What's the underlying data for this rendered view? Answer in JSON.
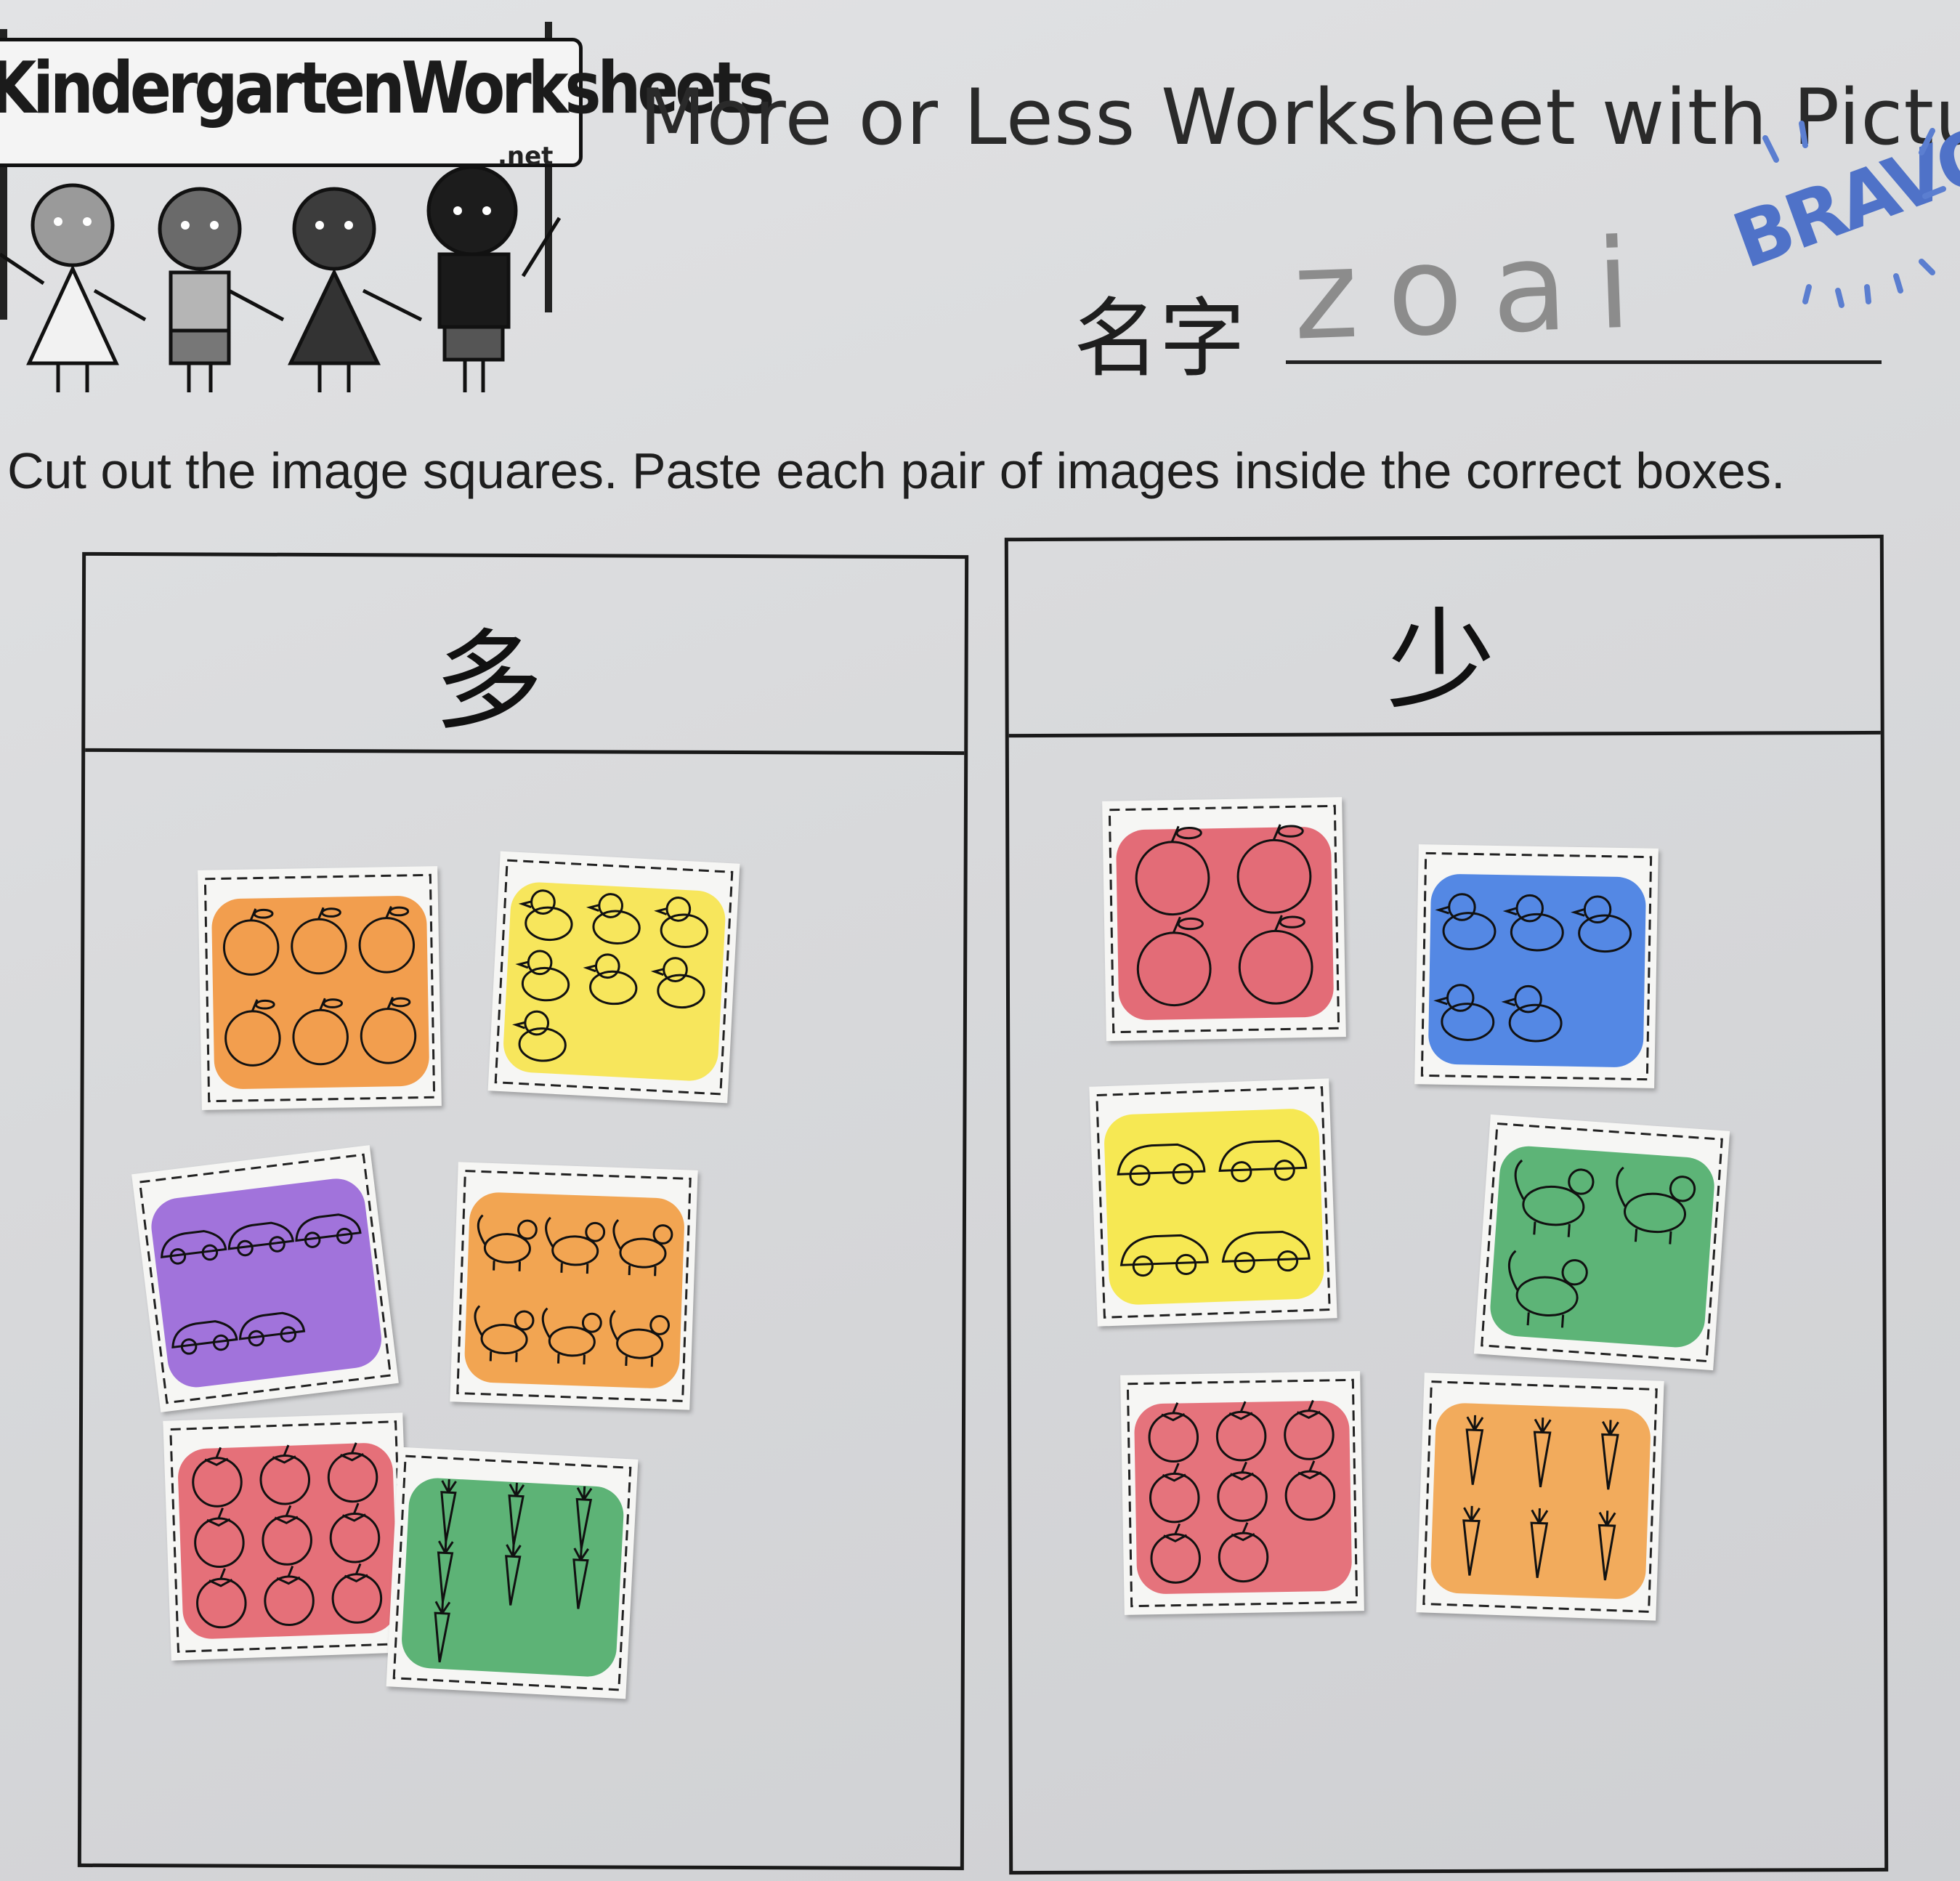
{
  "logo": {
    "brand": "KindergartenWorksheets",
    "suffix": ".net"
  },
  "worksheet_title": "More or Less Worksheet with Pictures",
  "name_field": {
    "label": "名字",
    "value": "zoai"
  },
  "stamp": "BRAVO",
  "instruction": "Cut out the image squares. Paste each pair of images inside the correct boxes.",
  "boxes": [
    {
      "heading": "多",
      "cards": [
        {
          "object": "apple",
          "count": 6,
          "color": "#f08a2a"
        },
        {
          "object": "duck",
          "count": 7,
          "color": "#f6e23a"
        },
        {
          "object": "car",
          "count": 5,
          "color": "#8e56d6"
        },
        {
          "object": "cat",
          "count": 6,
          "color": "#f0922e"
        },
        {
          "object": "tomato",
          "count": 9,
          "color": "#e0525e"
        },
        {
          "object": "carrot",
          "count": 7,
          "color": "#3aa35a"
        }
      ]
    },
    {
      "heading": "少",
      "cards": [
        {
          "object": "apple",
          "count": 4,
          "color": "#de4d5c"
        },
        {
          "object": "duck",
          "count": 5,
          "color": "#2f6fe0"
        },
        {
          "object": "car",
          "count": 4,
          "color": "#f5e430"
        },
        {
          "object": "cat",
          "count": 3,
          "color": "#3aa55c"
        },
        {
          "object": "tomato",
          "count": 8,
          "color": "#e05561"
        },
        {
          "object": "carrot",
          "count": 6,
          "color": "#f09a3a"
        }
      ]
    }
  ]
}
